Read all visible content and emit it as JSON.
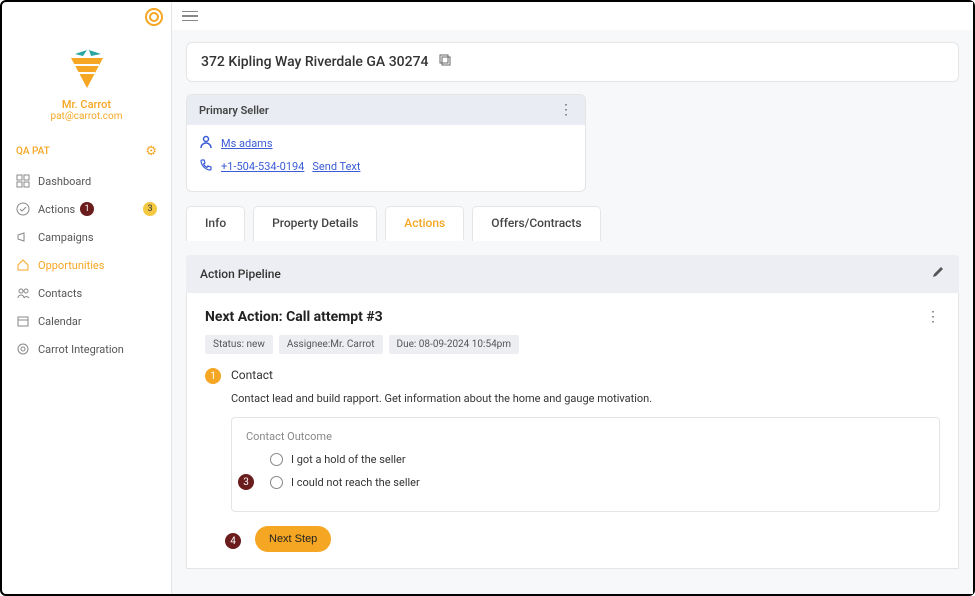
{
  "user": {
    "name": "Mr. Carrot",
    "email": "pat@carrot.com"
  },
  "workspace": {
    "label": "QA PAT"
  },
  "nav": {
    "dashboard": "Dashboard",
    "actions": "Actions",
    "actions_badge_dark": "1",
    "actions_badge_yellow": "3",
    "campaigns": "Campaigns",
    "opportunities": "Opportunities",
    "contacts": "Contacts",
    "calendar": "Calendar",
    "carrot_integration": "Carrot Integration"
  },
  "address": "372 Kipling Way Riverdale GA 30274",
  "seller": {
    "header": "Primary Seller",
    "name": "Ms adams",
    "phone": "+1-504-534-0194",
    "send_text": "Send Text"
  },
  "tabs": {
    "info": "Info",
    "property": "Property Details",
    "actions": "Actions",
    "offers": "Offers/Contracts"
  },
  "pipeline": {
    "header": "Action Pipeline",
    "title": "Next Action: Call attempt #3",
    "status": "Status: new",
    "assignee": "Assignee:Mr. Carrot",
    "due": "Due: 08-09-2024 10:54pm",
    "step_num": "1",
    "step_label": "Contact",
    "step_desc": "Contact lead and build rapport. Get information about the home and gauge motivation.",
    "outcome_title": "Contact Outcome",
    "option1": "I got a hold of the seller",
    "option2": "I could not reach the seller",
    "next_step": "Next Step"
  },
  "annotations": {
    "a3": "3",
    "a4": "4"
  }
}
